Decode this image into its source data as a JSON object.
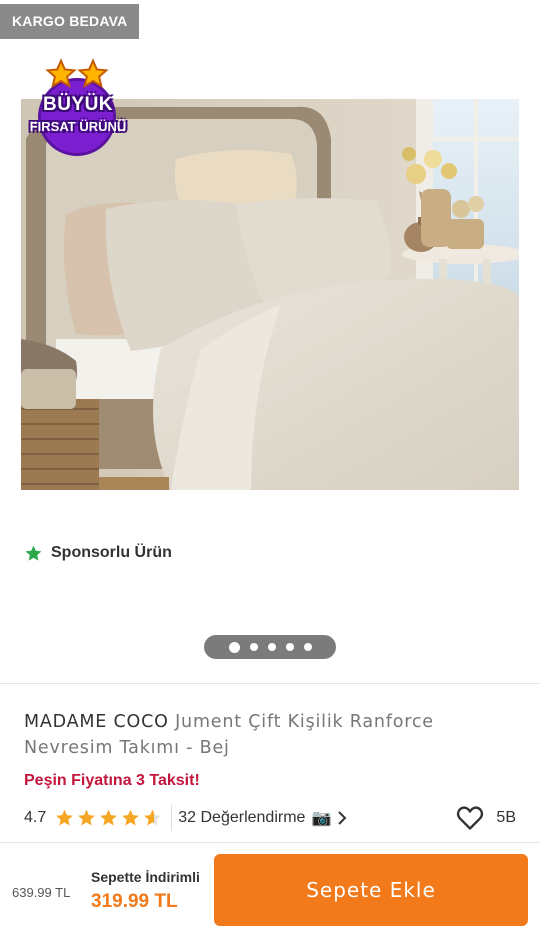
{
  "badges": {
    "cargo": "KARGO BEDAVA",
    "deal_line1": "BÜYÜK",
    "deal_line2": "FIRSAT ÜRÜNÜ"
  },
  "image": {
    "alt": "MADAME COCO Jument Çift Kişilik Ranforce Nevresim Takımı - Bej"
  },
  "sponsor": {
    "label": "Sponsorlu Ürün",
    "icon": "star-icon"
  },
  "carousel": {
    "total": 5,
    "active_index": 0
  },
  "product": {
    "brand": "MADAME COCO",
    "name": "Jument Çift Kişilik Ranforce Nevresim Takımı - Bej",
    "installment_text": "Peşin Fiyatına 3 Taksit!"
  },
  "rating": {
    "value": "4.7",
    "stars": 4.7,
    "reviews": "32 Değerlendirme",
    "camera_icon": "📷",
    "favorites": "5B"
  },
  "pricing": {
    "old_price": "639.99 TL",
    "basket_label": "Sepette İndirimli",
    "new_price": "319.99 TL",
    "add_button": "Sepete Ekle"
  },
  "colors": {
    "accent": "#f27a1a",
    "installment": "#c3163c",
    "star": "#f5a623",
    "sponsor_star": "#2aa84a",
    "deal_purple": "#7c1fd1"
  }
}
